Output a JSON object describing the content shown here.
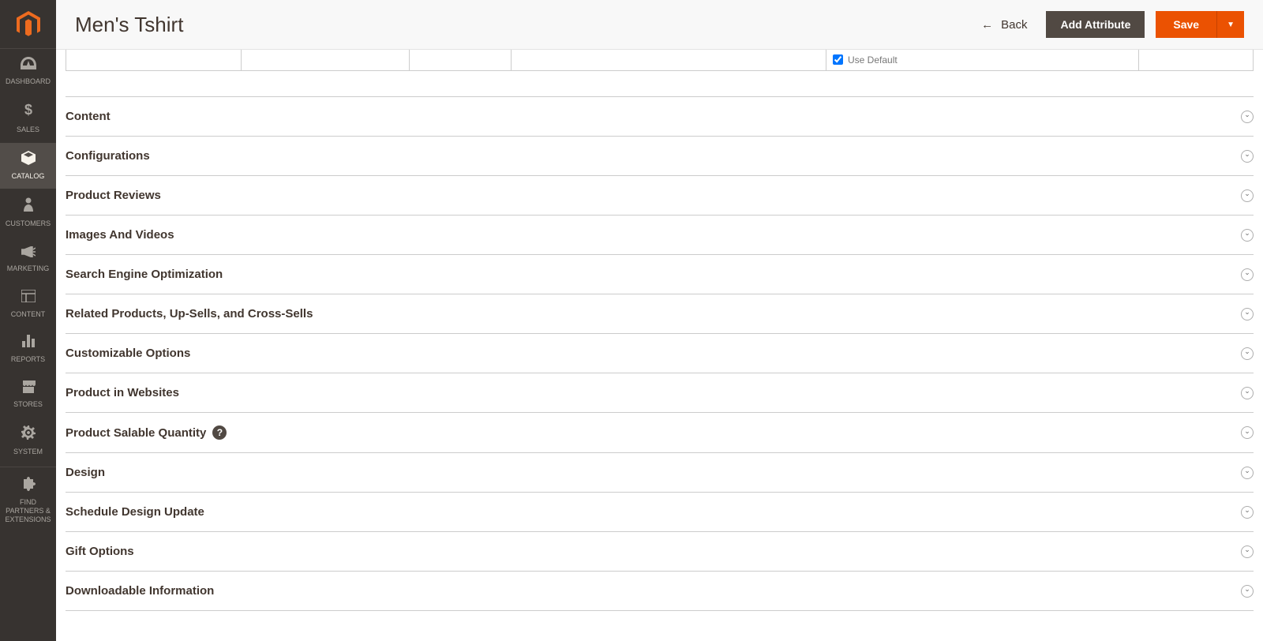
{
  "header": {
    "title": "Men's Tshirt",
    "back_label": "Back",
    "add_attribute_label": "Add Attribute",
    "save_label": "Save"
  },
  "sidebar": {
    "items": [
      {
        "label": "DASHBOARD",
        "icon": "dashboard"
      },
      {
        "label": "SALES",
        "icon": "dollar"
      },
      {
        "label": "CATALOG",
        "icon": "box",
        "active": true
      },
      {
        "label": "CUSTOMERS",
        "icon": "person"
      },
      {
        "label": "MARKETING",
        "icon": "megaphone"
      },
      {
        "label": "CONTENT",
        "icon": "layout"
      },
      {
        "label": "REPORTS",
        "icon": "bars"
      },
      {
        "label": "STORES",
        "icon": "storefront"
      },
      {
        "label": "SYSTEM",
        "icon": "gear"
      },
      {
        "label": "FIND PARTNERS & EXTENSIONS",
        "icon": "puzzle"
      }
    ]
  },
  "partial_row": {
    "use_default_label": "Use Default",
    "use_default_checked": true
  },
  "sections": [
    {
      "title": "Content"
    },
    {
      "title": "Configurations"
    },
    {
      "title": "Product Reviews"
    },
    {
      "title": "Images And Videos"
    },
    {
      "title": "Search Engine Optimization"
    },
    {
      "title": "Related Products, Up-Sells, and Cross-Sells"
    },
    {
      "title": "Customizable Options"
    },
    {
      "title": "Product in Websites"
    },
    {
      "title": "Product Salable Quantity",
      "help": true
    },
    {
      "title": "Design"
    },
    {
      "title": "Schedule Design Update"
    },
    {
      "title": "Gift Options"
    },
    {
      "title": "Downloadable Information"
    }
  ]
}
